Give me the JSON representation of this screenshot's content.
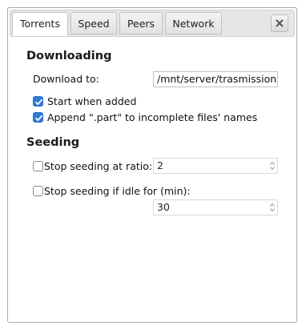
{
  "tabs": [
    {
      "label": "Torrents",
      "active": true
    },
    {
      "label": "Speed",
      "active": false
    },
    {
      "label": "Peers",
      "active": false
    },
    {
      "label": "Network",
      "active": false
    }
  ],
  "close_icon": "close-x-icon",
  "downloading": {
    "title": "Downloading",
    "download_to_label": "Download to:",
    "download_to_value": "/mnt/server/trasmission",
    "start_when_added_label": "Start when added",
    "start_when_added_checked": true,
    "append_part_label": "Append \".part\" to incomplete files' names",
    "append_part_checked": true
  },
  "seeding": {
    "title": "Seeding",
    "stop_ratio_label": "Stop seeding at ratio:",
    "stop_ratio_checked": false,
    "stop_ratio_value": "2",
    "stop_idle_label": "Stop seeding if idle for (min):",
    "stop_idle_checked": false,
    "stop_idle_value": "30"
  },
  "colors": {
    "checkbox_checked": "#2e7bd9",
    "border": "#a8a8a8"
  }
}
